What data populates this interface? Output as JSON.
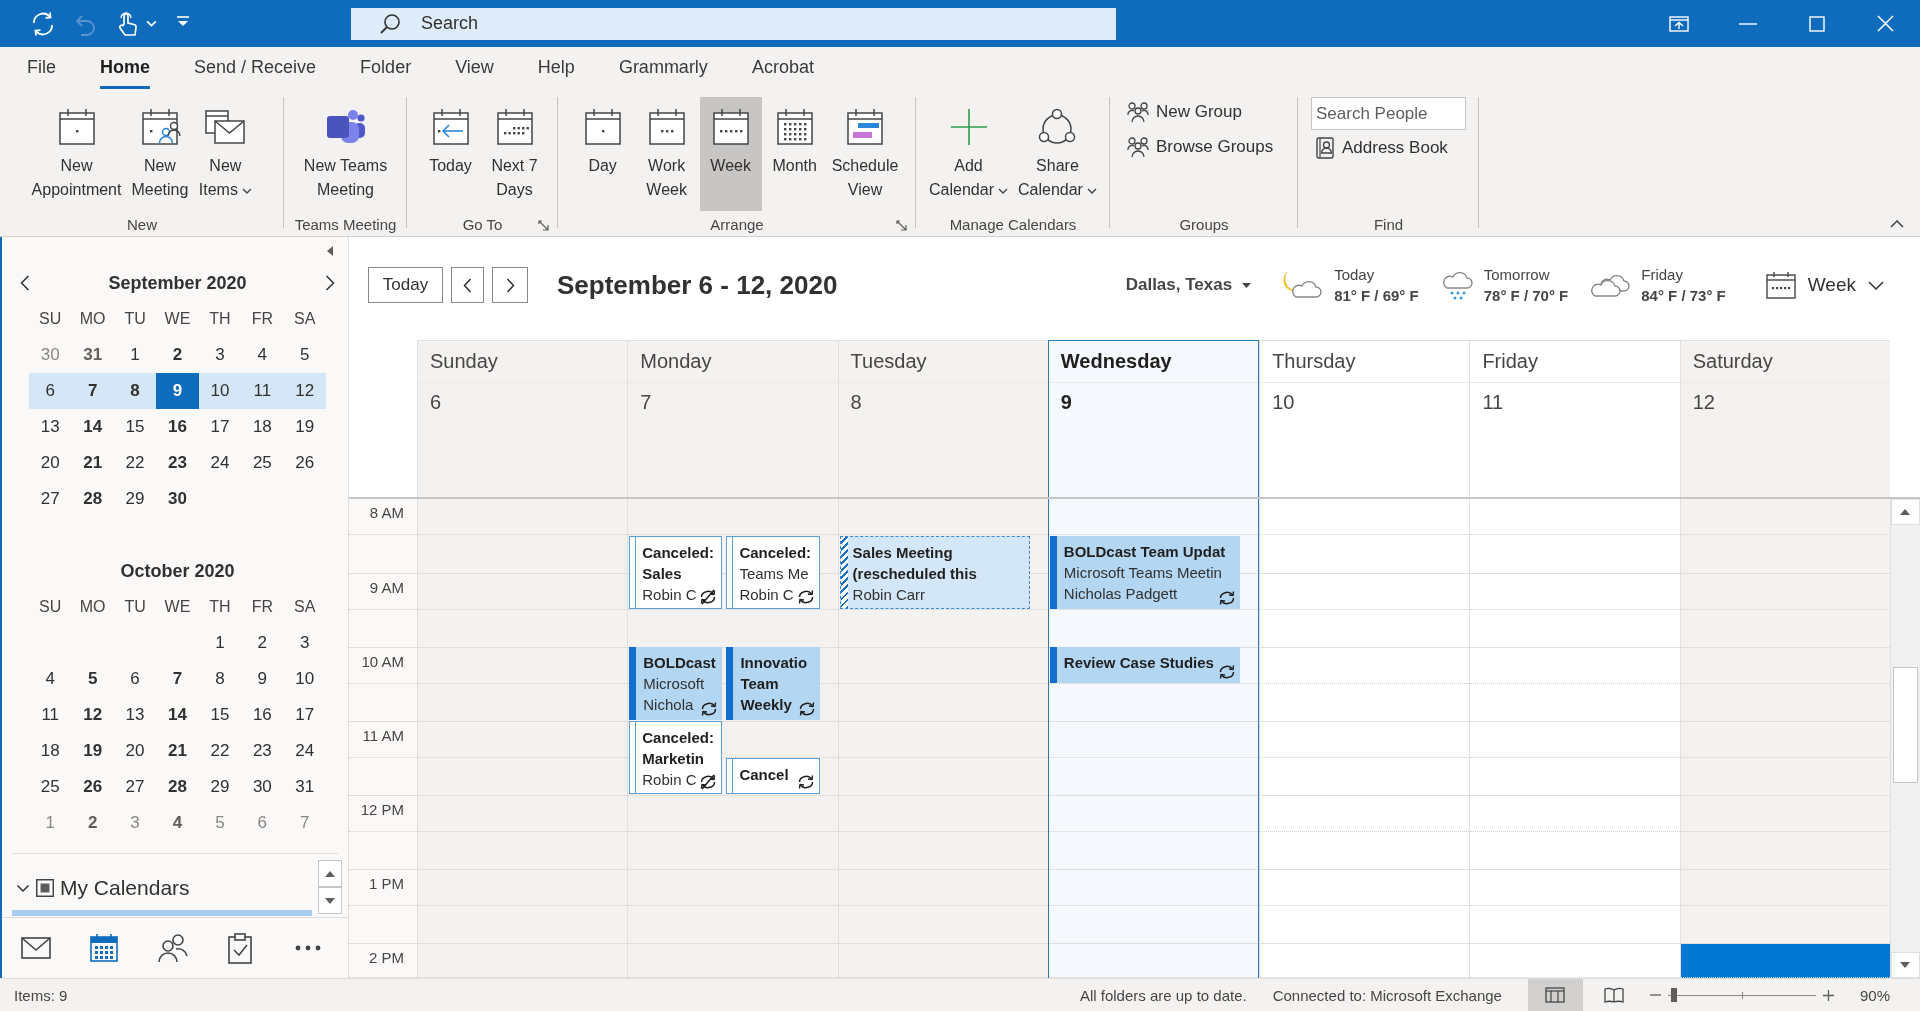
{
  "title_bar": {
    "quick_access": [
      {
        "disabled": false
      },
      {
        "disabled": true
      },
      {
        "disabled": false,
        "dropdown": true
      },
      {
        "disabled": false
      }
    ],
    "search": {
      "placeholder": "Search"
    }
  },
  "ribbon": {
    "tabs": [
      {
        "label": "File",
        "selected": false
      },
      {
        "label": "Home",
        "selected": true
      },
      {
        "label": "Send / Receive",
        "selected": false
      },
      {
        "label": "Folder",
        "selected": false
      },
      {
        "label": "View",
        "selected": false
      },
      {
        "label": "Help",
        "selected": false
      },
      {
        "label": "Grammarly",
        "selected": false
      },
      {
        "label": "Acrobat",
        "selected": false
      }
    ],
    "groups": [
      {
        "label": "New",
        "items": [
          {
            "kind": "large",
            "lines": [
              "New",
              "Appointment"
            ]
          },
          {
            "kind": "large",
            "lines": [
              "New",
              "Meeting"
            ]
          },
          {
            "kind": "large",
            "lines": [
              "New",
              "Items"
            ],
            "dropdown": true
          }
        ]
      },
      {
        "label": "Teams Meeting",
        "items": [
          {
            "kind": "large",
            "lines": [
              "New Teams",
              "Meeting"
            ]
          }
        ]
      },
      {
        "label": "Go To",
        "launcher": true,
        "items": [
          {
            "kind": "large",
            "lines": [
              "Today"
            ]
          },
          {
            "kind": "large",
            "lines": [
              "Next 7",
              "Days"
            ]
          }
        ]
      },
      {
        "label": "Arrange",
        "launcher": true,
        "items": [
          {
            "kind": "large",
            "lines": [
              "Day"
            ],
            "selected": false
          },
          {
            "kind": "large",
            "lines": [
              "Work",
              "Week"
            ],
            "selected": false
          },
          {
            "kind": "large",
            "lines": [
              "Week"
            ],
            "selected": true
          },
          {
            "kind": "large",
            "lines": [
              "Month"
            ],
            "selected": false
          },
          {
            "kind": "large",
            "lines": [
              "Schedule",
              "View"
            ],
            "selected": false
          }
        ]
      },
      {
        "label": "Manage Calendars",
        "items": [
          {
            "kind": "large",
            "lines": [
              "Add",
              "Calendar"
            ],
            "dropdown": true
          },
          {
            "kind": "large",
            "lines": [
              "Share",
              "Calendar"
            ],
            "dropdown": true
          }
        ]
      },
      {
        "label": "Groups",
        "items": [
          {
            "kind": "small",
            "lines": [
              "New Group"
            ]
          },
          {
            "kind": "small",
            "lines": [
              "Browse Groups"
            ]
          }
        ]
      },
      {
        "label": "Find",
        "items": [
          {
            "kind": "field",
            "placeholder": "Search People"
          },
          {
            "kind": "small",
            "lines": [
              "Address Book"
            ]
          }
        ]
      }
    ]
  },
  "navigation_pane": {
    "months": [
      {
        "title": "September 2020",
        "weekdays": [
          "SU",
          "MO",
          "TU",
          "WE",
          "TH",
          "FR",
          "SA"
        ],
        "weeks": [
          {
            "selected": false,
            "days": [
              {
                "day": "30",
                "bold": false,
                "other_month": true,
                "selected": false
              },
              {
                "day": "31",
                "bold": true,
                "other_month": true,
                "selected": false
              },
              {
                "day": "1",
                "bold": false,
                "other_month": false,
                "selected": false
              },
              {
                "day": "2",
                "bold": true,
                "other_month": false,
                "selected": false
              },
              {
                "day": "3",
                "bold": false,
                "other_month": false,
                "selected": false
              },
              {
                "day": "4",
                "bold": false,
                "other_month": false,
                "selected": false
              },
              {
                "day": "5",
                "bold": false,
                "other_month": false,
                "selected": false
              }
            ]
          },
          {
            "selected": true,
            "days": [
              {
                "day": "6",
                "bold": false,
                "other_month": false,
                "selected": false
              },
              {
                "day": "7",
                "bold": true,
                "other_month": false,
                "selected": false
              },
              {
                "day": "8",
                "bold": true,
                "other_month": false,
                "selected": false
              },
              {
                "day": "9",
                "bold": true,
                "other_month": false,
                "selected": true
              },
              {
                "day": "10",
                "bold": false,
                "other_month": false,
                "selected": false
              },
              {
                "day": "11",
                "bold": false,
                "other_month": false,
                "selected": false
              },
              {
                "day": "12",
                "bold": false,
                "other_month": false,
                "selected": false
              }
            ]
          },
          {
            "selected": false,
            "days": [
              {
                "day": "13",
                "bold": false,
                "other_month": false,
                "selected": false
              },
              {
                "day": "14",
                "bold": true,
                "other_month": false,
                "selected": false
              },
              {
                "day": "15",
                "bold": false,
                "other_month": false,
                "selected": false
              },
              {
                "day": "16",
                "bold": true,
                "other_month": false,
                "selected": false
              },
              {
                "day": "17",
                "bold": false,
                "other_month": false,
                "selected": false
              },
              {
                "day": "18",
                "bold": false,
                "other_month": false,
                "selected": false
              },
              {
                "day": "19",
                "bold": false,
                "other_month": false,
                "selected": false
              }
            ]
          },
          {
            "selected": false,
            "days": [
              {
                "day": "20",
                "bold": false,
                "other_month": false,
                "selected": false
              },
              {
                "day": "21",
                "bold": true,
                "other_month": false,
                "selected": false
              },
              {
                "day": "22",
                "bold": false,
                "other_month": false,
                "selected": false
              },
              {
                "day": "23",
                "bold": true,
                "other_month": false,
                "selected": false
              },
              {
                "day": "24",
                "bold": false,
                "other_month": false,
                "selected": false
              },
              {
                "day": "25",
                "bold": false,
                "other_month": false,
                "selected": false
              },
              {
                "day": "26",
                "bold": false,
                "other_month": false,
                "selected": false
              }
            ]
          },
          {
            "selected": false,
            "days": [
              {
                "day": "27",
                "bold": false,
                "other_month": false,
                "selected": false
              },
              {
                "day": "28",
                "bold": true,
                "other_month": false,
                "selected": false
              },
              {
                "day": "29",
                "bold": false,
                "other_month": false,
                "selected": false
              },
              {
                "day": "30",
                "bold": true,
                "other_month": false,
                "selected": false
              }
            ]
          }
        ]
      },
      {
        "title": "October 2020",
        "weekdays": [
          "SU",
          "MO",
          "TU",
          "WE",
          "TH",
          "FR",
          "SA"
        ],
        "weeks": [
          {
            "selected": false,
            "days": [
              {
                "day": "1",
                "bold": false,
                "other_month": false,
                "selected": false
              },
              {
                "day": "2",
                "bold": false,
                "other_month": false,
                "selected": false
              },
              {
                "day": "3",
                "bold": false,
                "other_month": false,
                "selected": false
              }
            ]
          },
          {
            "selected": false,
            "days": [
              {
                "day": "4",
                "bold": false,
                "other_month": false,
                "selected": false
              },
              {
                "day": "5",
                "bold": true,
                "other_month": false,
                "selected": false
              },
              {
                "day": "6",
                "bold": false,
                "other_month": false,
                "selected": false
              },
              {
                "day": "7",
                "bold": true,
                "other_month": false,
                "selected": false
              },
              {
                "day": "8",
                "bold": false,
                "other_month": false,
                "selected": false
              },
              {
                "day": "9",
                "bold": false,
                "other_month": false,
                "selected": false
              },
              {
                "day": "10",
                "bold": false,
                "other_month": false,
                "selected": false
              }
            ]
          },
          {
            "selected": false,
            "days": [
              {
                "day": "11",
                "bold": false,
                "other_month": false,
                "selected": false
              },
              {
                "day": "12",
                "bold": true,
                "other_month": false,
                "selected": false
              },
              {
                "day": "13",
                "bold": false,
                "other_month": false,
                "selected": false
              },
              {
                "day": "14",
                "bold": true,
                "other_month": false,
                "selected": false
              },
              {
                "day": "15",
                "bold": false,
                "other_month": false,
                "selected": false
              },
              {
                "day": "16",
                "bold": false,
                "other_month": false,
                "selected": false
              },
              {
                "day": "17",
                "bold": false,
                "other_month": false,
                "selected": false
              }
            ]
          },
          {
            "selected": false,
            "days": [
              {
                "day": "18",
                "bold": false,
                "other_month": false,
                "selected": false
              },
              {
                "day": "19",
                "bold": true,
                "other_month": false,
                "selected": false
              },
              {
                "day": "20",
                "bold": false,
                "other_month": false,
                "selected": false
              },
              {
                "day": "21",
                "bold": true,
                "other_month": false,
                "selected": false
              },
              {
                "day": "22",
                "bold": false,
                "other_month": false,
                "selected": false
              },
              {
                "day": "23",
                "bold": false,
                "other_month": false,
                "selected": false
              },
              {
                "day": "24",
                "bold": false,
                "other_month": false,
                "selected": false
              }
            ]
          },
          {
            "selected": false,
            "days": [
              {
                "day": "25",
                "bold": false,
                "other_month": false,
                "selected": false
              },
              {
                "day": "26",
                "bold": true,
                "other_month": false,
                "selected": false
              },
              {
                "day": "27",
                "bold": false,
                "other_month": false,
                "selected": false
              },
              {
                "day": "28",
                "bold": true,
                "other_month": false,
                "selected": false
              },
              {
                "day": "29",
                "bold": false,
                "other_month": false,
                "selected": false
              },
              {
                "day": "30",
                "bold": false,
                "other_month": false,
                "selected": false
              },
              {
                "day": "31",
                "bold": false,
                "other_month": false,
                "selected": false
              }
            ]
          },
          {
            "selected": false,
            "days": [
              {
                "day": "1",
                "bold": false,
                "other_month": true,
                "selected": false
              },
              {
                "day": "2",
                "bold": true,
                "other_month": true,
                "selected": false
              },
              {
                "day": "3",
                "bold": false,
                "other_month": true,
                "selected": false
              },
              {
                "day": "4",
                "bold": true,
                "other_month": true,
                "selected": false
              },
              {
                "day": "5",
                "bold": false,
                "other_month": true,
                "selected": false
              },
              {
                "day": "6",
                "bold": false,
                "other_month": true,
                "selected": false
              },
              {
                "day": "7",
                "bold": false,
                "other_month": true,
                "selected": false
              }
            ]
          }
        ]
      }
    ],
    "my_calendars": {
      "label": "My Calendars",
      "expanded": true,
      "partially_checked": true
    },
    "nav_bar": [
      {
        "selected": false
      },
      {
        "selected": true
      },
      {
        "selected": false
      },
      {
        "selected": false
      },
      {
        "selected": false
      }
    ]
  },
  "calendar": {
    "today_button": "Today",
    "range_title": "September 6 - 12, 2020",
    "location": "Dallas, Texas",
    "forecast": [
      {
        "day": "Today",
        "temperature": "81° F / 69° F"
      },
      {
        "day": "Tomorrow",
        "temperature": "78° F / 70° F"
      },
      {
        "day": "Friday",
        "temperature": "84° F / 73° F"
      }
    ],
    "view": "Week",
    "days": [
      {
        "name": "Sunday",
        "date": "6",
        "today": false,
        "shaded": true
      },
      {
        "name": "Monday",
        "date": "7",
        "today": false,
        "shaded": true
      },
      {
        "name": "Tuesday",
        "date": "8",
        "today": false,
        "shaded": true
      },
      {
        "name": "Wednesday",
        "date": "9",
        "today": true,
        "shaded": false
      },
      {
        "name": "Thursday",
        "date": "10",
        "today": false,
        "shaded": false
      },
      {
        "name": "Friday",
        "date": "11",
        "today": false,
        "shaded": false
      },
      {
        "name": "Saturday",
        "date": "12",
        "today": false,
        "shaded": true
      }
    ],
    "hours": [
      {
        "label": "8 AM",
        "cells": [
          {
            "selected": false
          },
          {
            "selected": false,
            "half_past_events": [
              {
                "kind": "canceled",
                "title": "Canceled: Sales",
                "details": [
                  "Robin C"
                ],
                "thirty_minutes": false,
                "recurrence": {
                  "kind": "exception"
                }
              },
              {
                "kind": "canceled",
                "title": "Canceled:",
                "details": [
                  "Teams Me",
                  "Robin C"
                ],
                "thirty_minutes": false,
                "recurrence": {
                  "kind": "series"
                }
              }
            ]
          },
          {
            "selected": false,
            "half_past_events": [
              {
                "kind": "tentative",
                "title": "Sales Meeting (rescheduled this",
                "details": [
                  "Robin Carr"
                ],
                "thirty_minutes": false
              }
            ]
          },
          {
            "selected": false,
            "half_past_events": [
              {
                "kind": "busy",
                "title": "BOLDcast Team Updat",
                "details": [
                  "Microsoft Teams Meetin",
                  "Nicholas Padgett"
                ],
                "thirty_minutes": false,
                "recurrence": {
                  "kind": "series"
                }
              }
            ]
          },
          {
            "selected": false
          },
          {
            "selected": false
          },
          {
            "selected": false
          }
        ]
      },
      {
        "label": "9 AM",
        "cells": [
          {
            "selected": false
          },
          {
            "selected": false
          },
          {
            "selected": false
          },
          {
            "selected": false
          },
          {
            "selected": false
          },
          {
            "selected": false
          },
          {
            "selected": false
          }
        ]
      },
      {
        "label": "10 AM",
        "cells": [
          {
            "selected": false
          },
          {
            "selected": false,
            "events": [
              {
                "kind": "busy",
                "title": "BOLDcast",
                "details": [
                  "Microsoft",
                  "Nichola"
                ],
                "thirty_minutes": false,
                "recurrence": {
                  "kind": "series"
                }
              },
              {
                "kind": "busy",
                "title": "Innovatio Team Weekly",
                "thirty_minutes": false,
                "recurrence": {
                  "kind": "series"
                }
              }
            ]
          },
          {
            "selected": false
          },
          {
            "selected": false,
            "events": [
              {
                "kind": "busy",
                "title": "Review Case Studies",
                "thirty_minutes": true,
                "recurrence": {
                  "kind": "series"
                }
              }
            ]
          },
          {
            "selected": false
          },
          {
            "selected": false
          },
          {
            "selected": false
          }
        ]
      },
      {
        "label": "11 AM",
        "cells": [
          {
            "selected": false
          },
          {
            "selected": false,
            "events": [
              {
                "kind": "canceled",
                "title": "Canceled: Marketin",
                "details": [
                  "Robin C"
                ],
                "thirty_minutes": false,
                "recurrence": {
                  "kind": "exception"
                }
              }
            ],
            "half_past_events": [
              {
                "kind": "canceled",
                "title": "Cancel",
                "thirty_minutes": true,
                "recurrence": {
                  "kind": "series"
                }
              }
            ]
          },
          {
            "selected": false
          },
          {
            "selected": false
          },
          {
            "selected": false
          },
          {
            "selected": false
          },
          {
            "selected": false
          }
        ]
      },
      {
        "label": "12 PM",
        "cells": [
          {
            "selected": false
          },
          {
            "selected": false
          },
          {
            "selected": false
          },
          {
            "selected": false
          },
          {
            "selected": false
          },
          {
            "selected": false
          },
          {
            "selected": false
          }
        ]
      },
      {
        "label": "1 PM",
        "cells": [
          {
            "selected": false
          },
          {
            "selected": false
          },
          {
            "selected": false
          },
          {
            "selected": false
          },
          {
            "selected": false
          },
          {
            "selected": false
          },
          {
            "selected": false
          }
        ]
      },
      {
        "label": "2 PM",
        "cells": [
          {
            "selected": false
          },
          {
            "selected": false
          },
          {
            "selected": false
          },
          {
            "selected": false
          },
          {
            "selected": false
          },
          {
            "selected": false
          },
          {
            "selected": true
          }
        ]
      }
    ]
  },
  "status_bar": {
    "items": "Items: 9",
    "sync": "All folders are up to date.",
    "connection": "Connected to: Microsoft Exchange",
    "views": [
      {
        "selected": true
      },
      {
        "selected": false
      }
    ],
    "zoom": {
      "level": 0.02,
      "label": "90%"
    }
  }
}
